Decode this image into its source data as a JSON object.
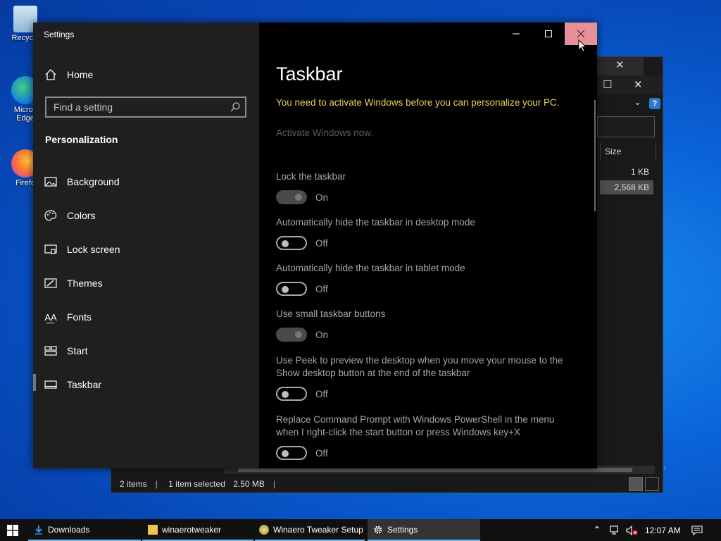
{
  "desktop": {
    "icons": [
      {
        "label": "Recycle",
        "name": "recycle-bin"
      },
      {
        "label": "Micros Edge",
        "name": "edge"
      },
      {
        "label": "Firefo",
        "name": "firefox"
      }
    ]
  },
  "explorer": {
    "column_size": "Size",
    "sizes": [
      "1 KB",
      "2,568 KB"
    ],
    "status": {
      "items": "2 items",
      "selected": "1 item selected",
      "size": "2.50 MB"
    }
  },
  "settings": {
    "window_title": "Settings",
    "home_label": "Home",
    "search_placeholder": "Find a setting",
    "section_title": "Personalization",
    "nav": [
      {
        "label": "Background",
        "icon": "image-icon"
      },
      {
        "label": "Colors",
        "icon": "palette-icon"
      },
      {
        "label": "Lock screen",
        "icon": "lock-screen-icon"
      },
      {
        "label": "Themes",
        "icon": "themes-icon"
      },
      {
        "label": "Fonts",
        "icon": "fonts-icon"
      },
      {
        "label": "Start",
        "icon": "start-icon"
      },
      {
        "label": "Taskbar",
        "icon": "taskbar-icon"
      }
    ],
    "active_nav": "Taskbar",
    "page_title": "Taskbar",
    "activation_note": "You need to activate Windows before you can personalize your PC.",
    "activate_link": "Activate Windows now.",
    "options": [
      {
        "label": "Lock the taskbar",
        "state": "On"
      },
      {
        "label": "Automatically hide the taskbar in desktop mode",
        "state": "Off"
      },
      {
        "label": "Automatically hide the taskbar in tablet mode",
        "state": "Off"
      },
      {
        "label": "Use small taskbar buttons",
        "state": "On"
      },
      {
        "label": "Use Peek to preview the desktop when you move your mouse to the Show desktop button at the end of the taskbar",
        "state": "Off"
      },
      {
        "label": "Replace Command Prompt with Windows PowerShell in the menu when I right-click the start button or press Windows key+X",
        "state": "Off"
      }
    ]
  },
  "taskbar": {
    "items": [
      {
        "label": "Downloads",
        "icon": "download-arrow-icon"
      },
      {
        "label": "winaerotweaker",
        "icon": "folder-icon"
      },
      {
        "label": "Winaero Tweaker Setup",
        "icon": "setup-icon"
      },
      {
        "label": "Settings",
        "icon": "gear-icon"
      }
    ],
    "clock": "12:07 AM"
  },
  "colors": {
    "accent_note": "#e3d45a",
    "close_hover": "#e8909a",
    "desktop_blue": "#0a63d8"
  }
}
